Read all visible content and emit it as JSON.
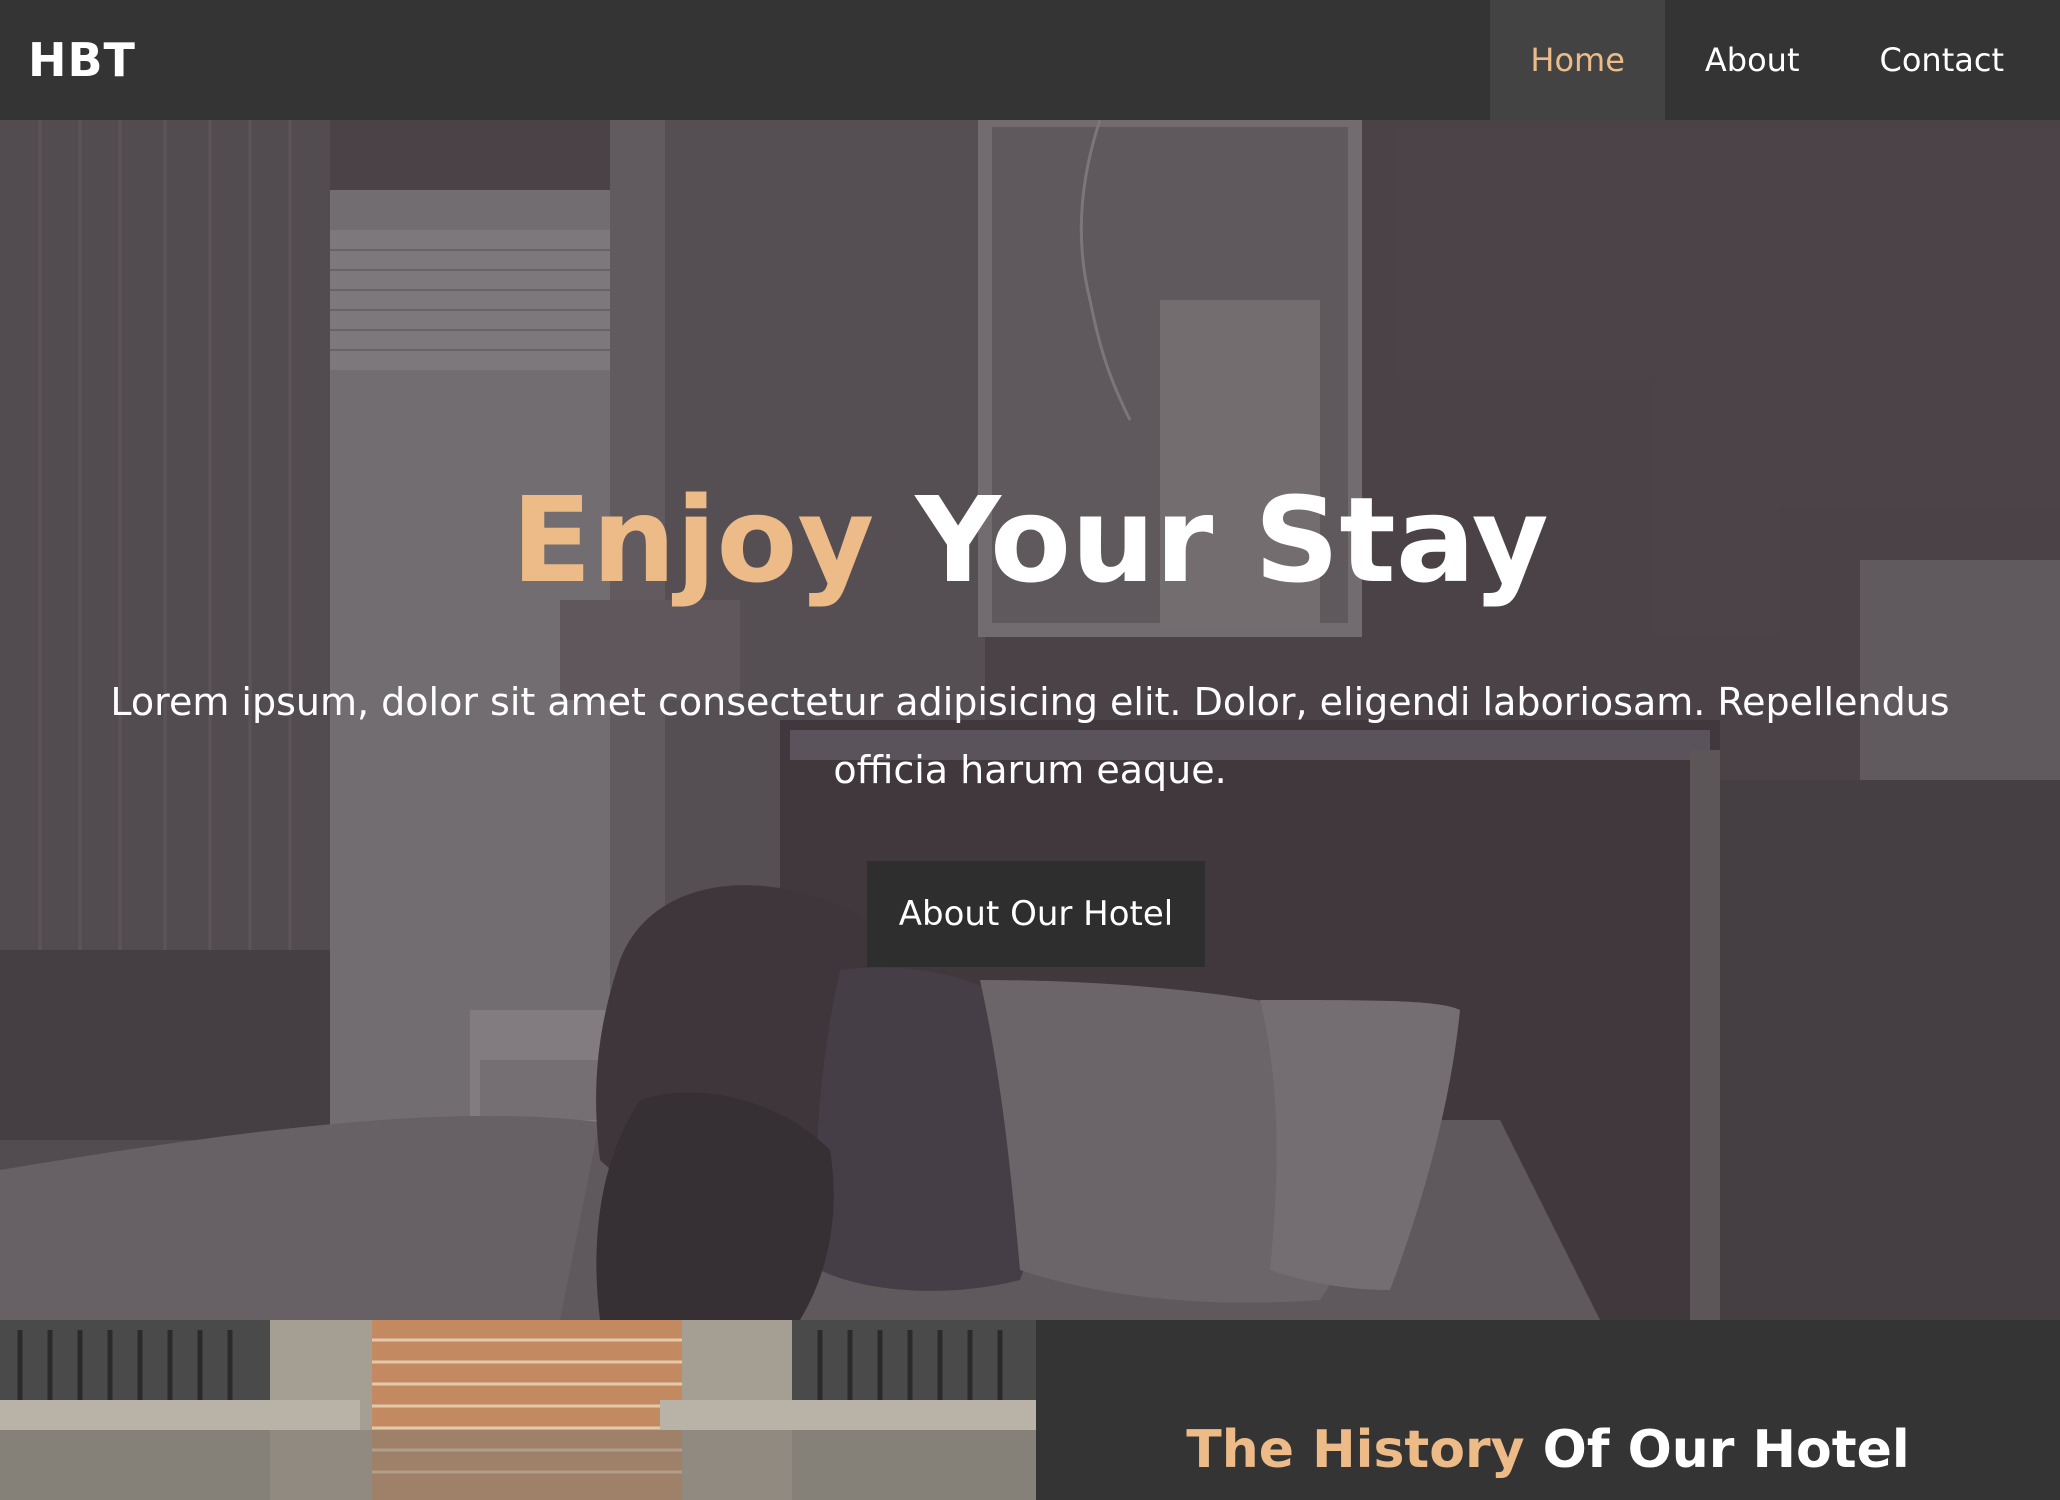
{
  "navbar": {
    "brand": "HBT",
    "links": [
      {
        "label": "Home",
        "active": true
      },
      {
        "label": "About",
        "active": false
      },
      {
        "label": "Contact",
        "active": false
      }
    ]
  },
  "hero": {
    "title_accent": "Enjoy",
    "title_rest": " Your Stay",
    "text": "Lorem ipsum, dolor sit amet consectetur adipisicing elit. Dolor, eligendi laboriosam. Repellendus officia harum eaque.",
    "button_label": "About Our Hotel"
  },
  "history": {
    "title_accent": "The History",
    "title_rest": " Of Our Hotel"
  },
  "colors": {
    "accent": "#ecbb87",
    "nav_bg": "#353435",
    "active_nav_bg": "#444344",
    "button_bg": "#2f2e2f"
  }
}
